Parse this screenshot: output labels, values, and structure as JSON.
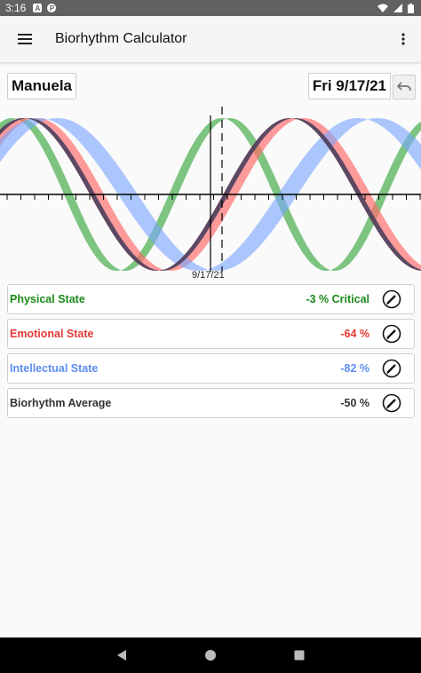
{
  "status_bar": {
    "time": "3:16"
  },
  "app_bar": {
    "title": "Biorhythm Calculator"
  },
  "person": {
    "name": "Manuela"
  },
  "date_selector": {
    "label": "Fri 9/17/21"
  },
  "chart_data": {
    "type": "area",
    "series": [
      {
        "name": "Physical",
        "color": "#4caf50"
      },
      {
        "name": "Emotional",
        "color": "#ff6b6b"
      },
      {
        "name": "Intellectual",
        "color": "#7aa7ff"
      },
      {
        "name": "Biorhythm Average",
        "color": "#4a3f5c"
      }
    ],
    "date_marker": "9/17/21"
  },
  "states": [
    {
      "label": "Physical State",
      "value": "-3 % Critical",
      "color": "#1a8a1a"
    },
    {
      "label": "Emotional State",
      "value": "-64 %",
      "color": "#e53935"
    },
    {
      "label": "Intellectual State",
      "value": "-82 %",
      "color": "#5b8def"
    },
    {
      "label": "Biorhythm Average",
      "value": "-50 %",
      "color": "#333333"
    }
  ]
}
